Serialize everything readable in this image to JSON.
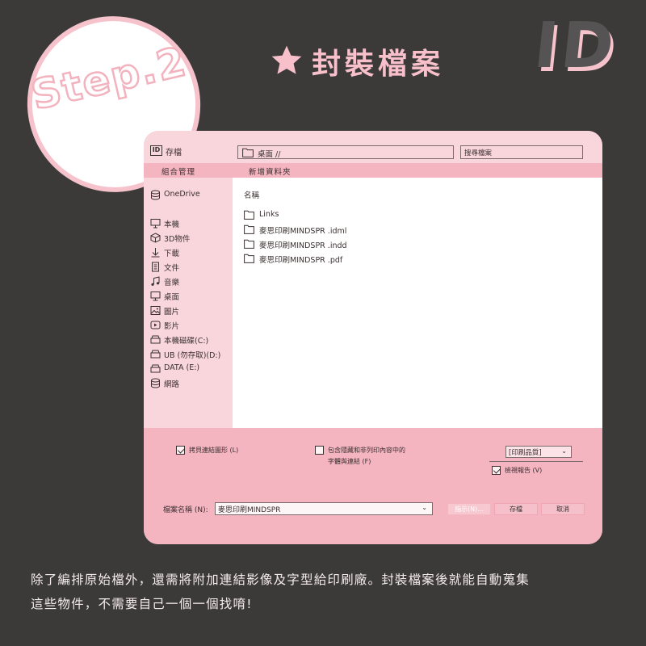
{
  "header": {
    "step_label": "Step.2",
    "title": "封裝檔案",
    "logo": "ID"
  },
  "dialog": {
    "title": "存檔",
    "app_icon": "ID",
    "path": "桌面 //",
    "search_placeholder": "搜尋檔案",
    "toolbar": {
      "organize": "組合管理",
      "new_folder": "新增資料夾"
    },
    "sidebar": {
      "items": [
        {
          "label": "OneDrive",
          "icon": "cloud-drive-icon"
        },
        {
          "label": "本機",
          "icon": "computer-icon"
        },
        {
          "label": "3D物件",
          "icon": "cube-icon"
        },
        {
          "label": "下載",
          "icon": "download-arrow-icon"
        },
        {
          "label": "文件",
          "icon": "document-icon"
        },
        {
          "label": "音樂",
          "icon": "music-note-icon"
        },
        {
          "label": "桌面",
          "icon": "monitor-icon"
        },
        {
          "label": "圖片",
          "icon": "image-icon"
        },
        {
          "label": "影片",
          "icon": "video-play-icon"
        },
        {
          "label": "本機磁碟(C:)",
          "icon": "drive-icon"
        },
        {
          "label": "UB (勿存取)(D:)",
          "icon": "drive-icon"
        },
        {
          "label": "DATA (E:)",
          "icon": "drive-icon"
        },
        {
          "label": "網路",
          "icon": "network-icon"
        }
      ]
    },
    "files": {
      "column_name": "名稱",
      "items": [
        {
          "name": "Links"
        },
        {
          "name": "麥思印刷MINDSPR .idml"
        },
        {
          "name": "麥思印刷MINDSPR .indd"
        },
        {
          "name": "麥思印刷MINDSPR .pdf"
        }
      ]
    },
    "options": {
      "copy_links": {
        "label": "拷貝連結圖形 (L)",
        "checked": true
      },
      "include_hidden_line1": "包含隱藏和非列印內容中的",
      "include_hidden_line2": "字體與連結 (F)",
      "include_hidden_checked": false,
      "quality": "[印刷品質]",
      "preflight_report": {
        "label": "檢視報告 (V)",
        "checked": true
      }
    },
    "filename_label": "檔案名稱 (N):",
    "filename_value": "麥思印刷MINDSPR",
    "buttons": {
      "hint": "指示(N)...",
      "save": "存檔",
      "cancel": "取消"
    }
  },
  "caption": {
    "line1": "除了編排原始檔外，還需將附加連結影像及字型給印刷廠。封裝檔案後就能自動蒐集",
    "line2": "這些物件，不需要自己一個一個找唷!"
  },
  "colors": {
    "background": "#3c3a39",
    "accent_pink": "#f4b4c0",
    "light_pink": "#f9d6dc",
    "text": "#3a3030"
  }
}
